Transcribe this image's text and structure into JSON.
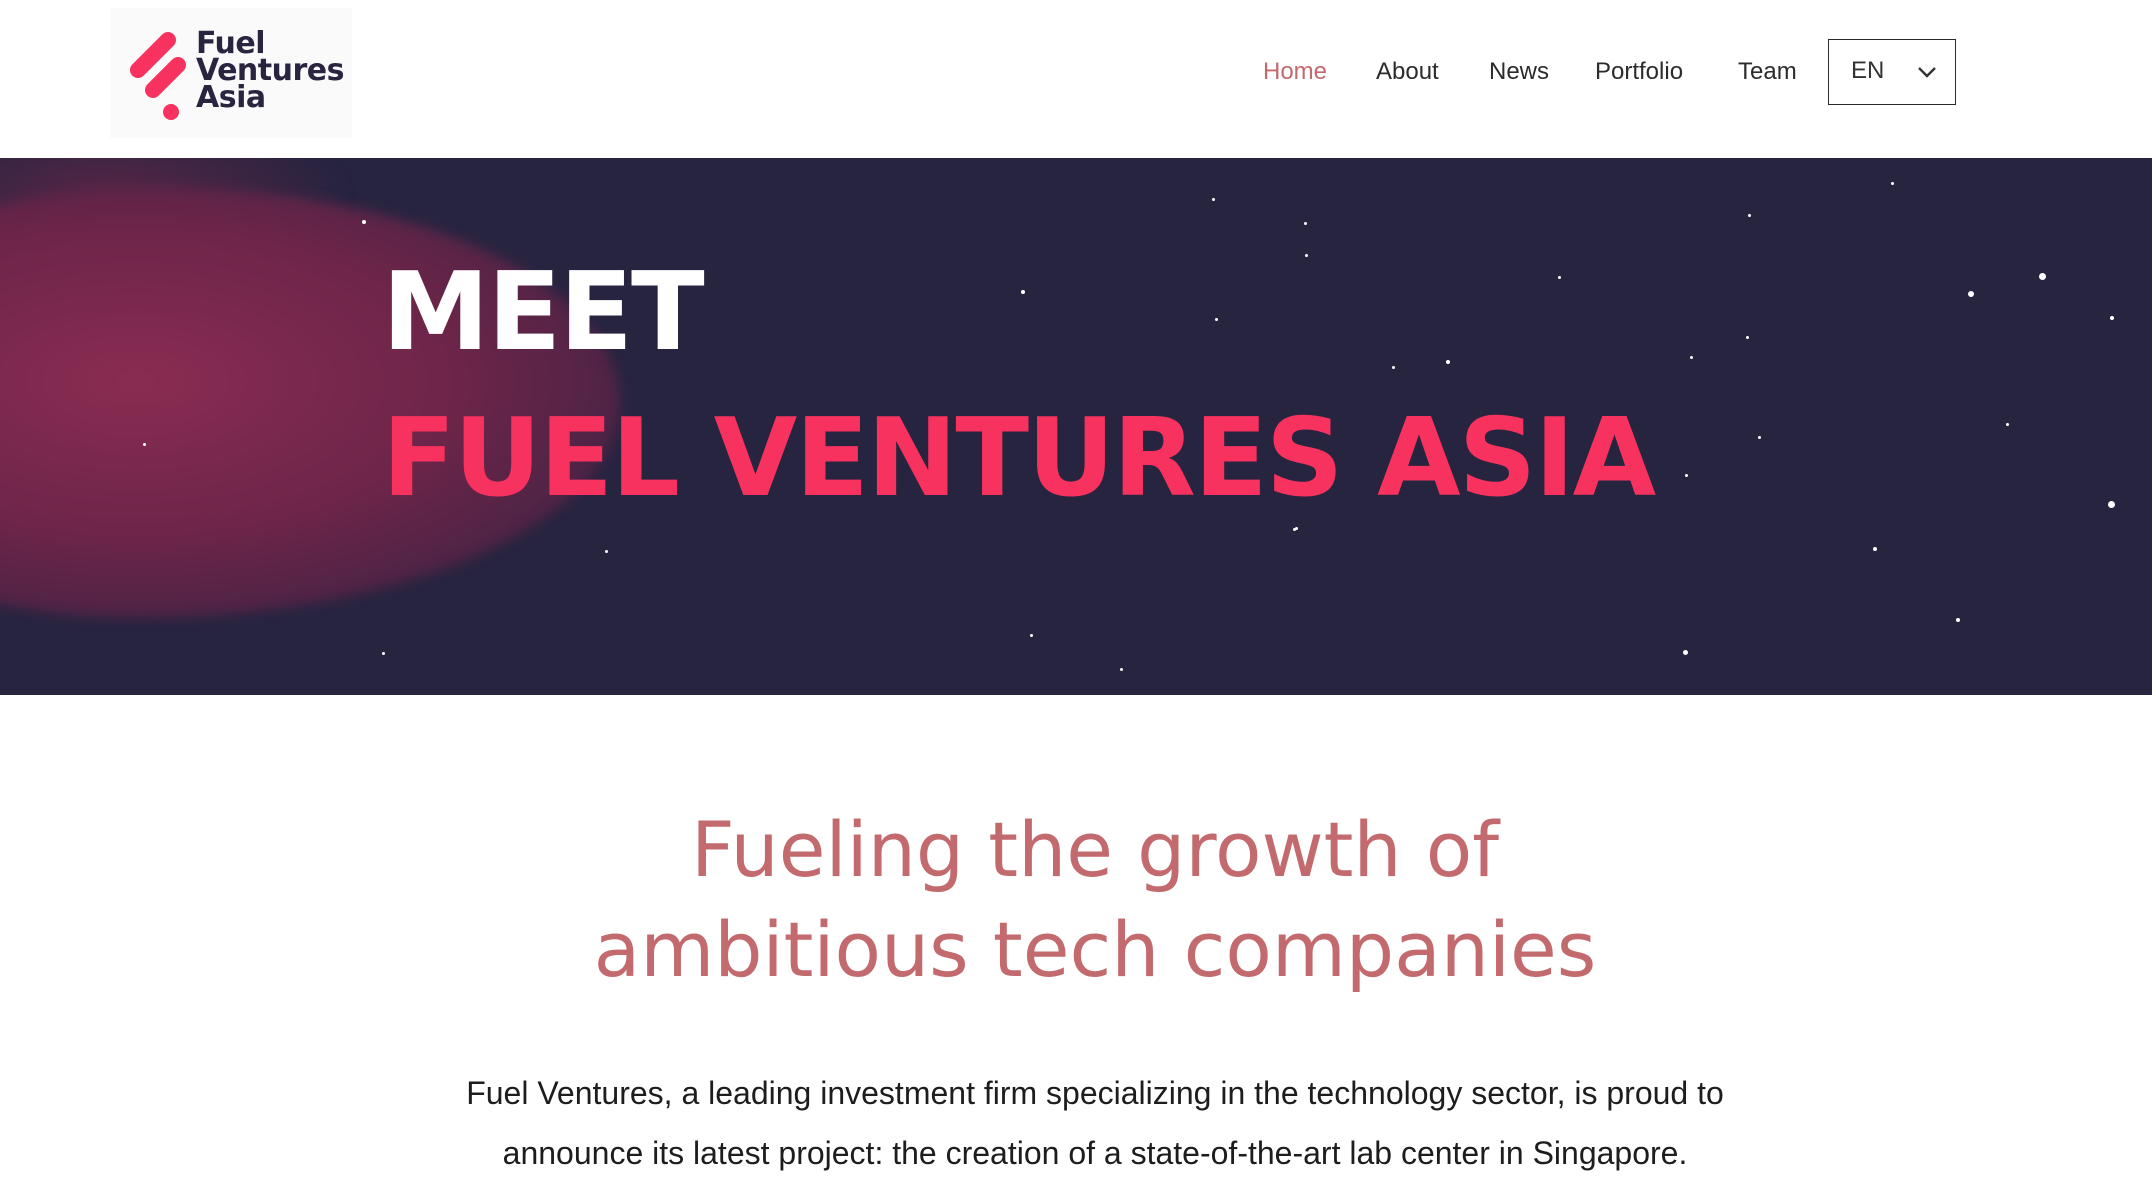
{
  "brand": {
    "name_lines": [
      "Fuel",
      "Ventures",
      "Asia"
    ],
    "accent_color": "#f7325e"
  },
  "nav": {
    "items": [
      {
        "label": "Home",
        "active": true
      },
      {
        "label": "About",
        "active": false
      },
      {
        "label": "News",
        "active": false
      },
      {
        "label": "Portfolio",
        "active": false
      },
      {
        "label": "Team",
        "active": false
      }
    ],
    "language": {
      "selected": "EN",
      "icon": "chevron-down-icon"
    }
  },
  "hero": {
    "line1": "MEET",
    "line2": "FUEL VENTURES ASIA",
    "background_color": "#272440",
    "headline_accent_color": "#f7325e"
  },
  "main": {
    "tagline_lines": [
      "Fueling the growth of",
      "ambitious tech companies"
    ],
    "tagline_color": "#c36a6e",
    "body_lines": [
      "Fuel Ventures, a leading investment firm specializing in the technology sector, is proud to",
      "announce its latest project: the creation of a state-of-the-art lab center in Singapore."
    ]
  }
}
